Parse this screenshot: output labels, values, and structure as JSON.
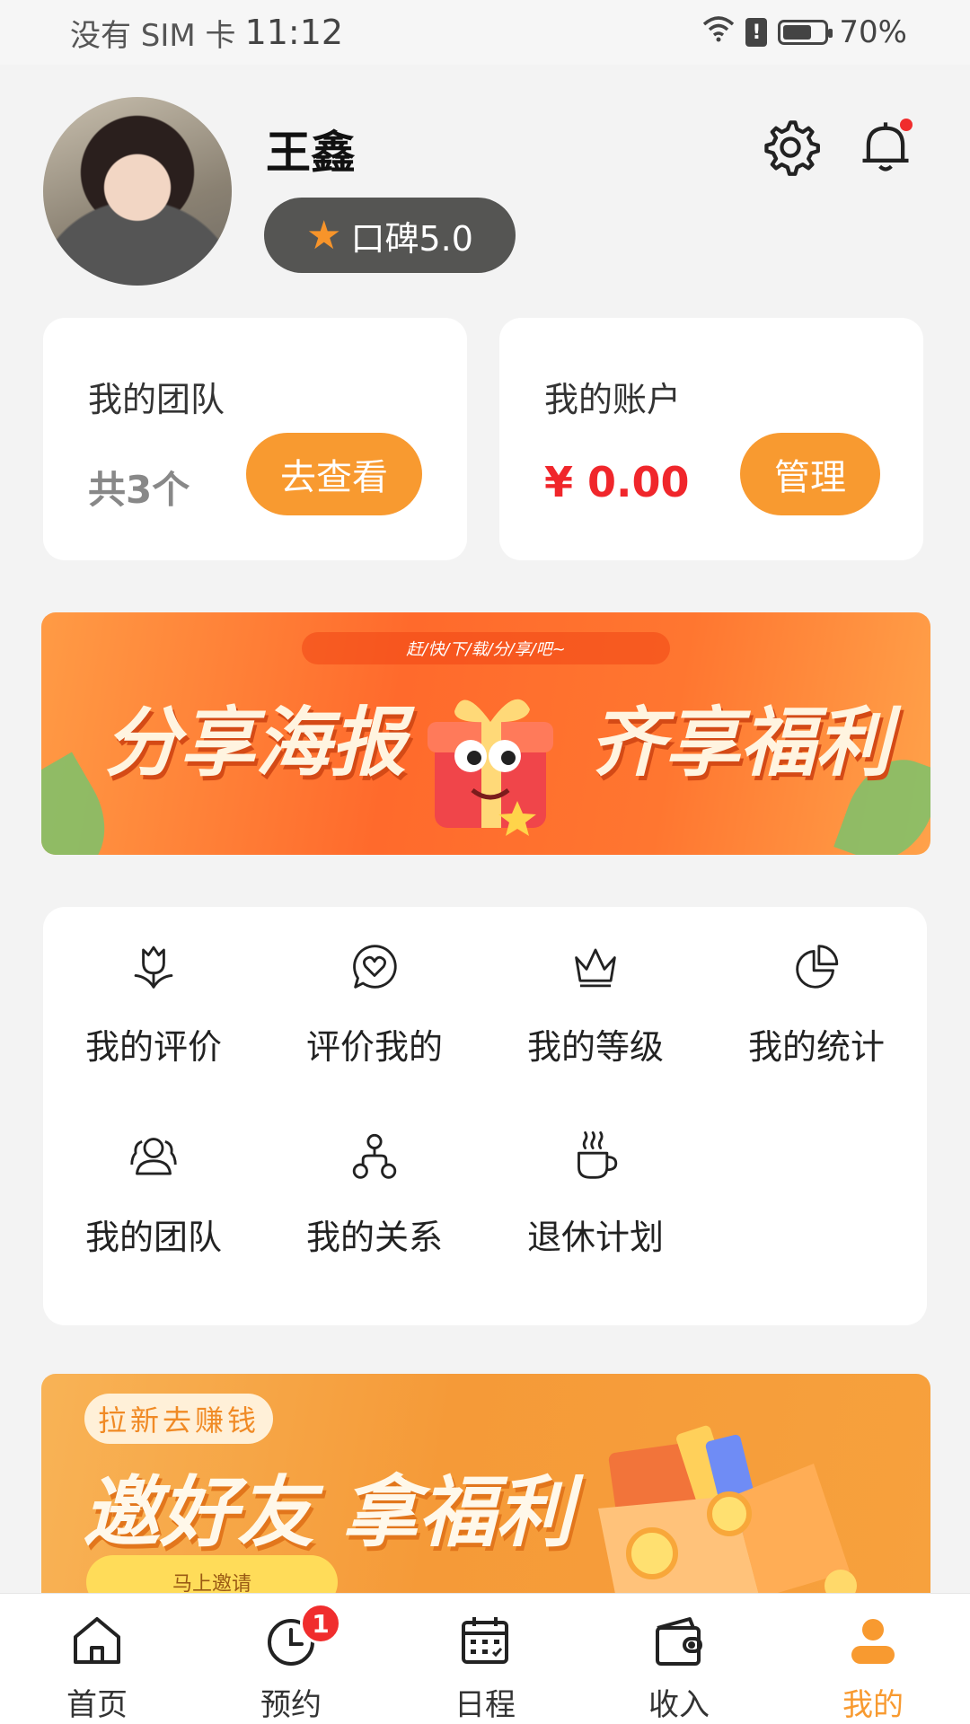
{
  "status_bar": {
    "carrier": "没有 SIM 卡",
    "time": "11:12",
    "battery": "70%",
    "battery_level": 0.7
  },
  "profile": {
    "name": "王鑫",
    "rating_label": "口碑5.0",
    "has_notification": true
  },
  "team_card": {
    "title": "我的团队",
    "count": "共3个",
    "button": "去查看"
  },
  "account_card": {
    "title": "我的账户",
    "balance": "¥ 0.00",
    "button": "管理"
  },
  "banner1": {
    "tag": "赶/快/下/载/分/享/吧~",
    "left_text": "分享海报",
    "right_text": "齐享福利"
  },
  "menu": {
    "items": [
      {
        "label": "我的评价",
        "icon": "tulip-icon"
      },
      {
        "label": "评价我的",
        "icon": "heart-chat-icon"
      },
      {
        "label": "我的等级",
        "icon": "crown-icon"
      },
      {
        "label": "我的统计",
        "icon": "pie-chart-icon"
      },
      {
        "label": "我的团队",
        "icon": "team-icon"
      },
      {
        "label": "我的关系",
        "icon": "relation-icon"
      },
      {
        "label": "退休计划",
        "icon": "coffee-cup-icon"
      }
    ]
  },
  "banner2": {
    "tag": "拉新去赚钱",
    "headline": "邀好友 拿福利",
    "button": "马上邀请"
  },
  "tabbar": {
    "tabs": [
      {
        "label": "首页",
        "icon": "home-icon"
      },
      {
        "label": "预约",
        "icon": "clock-icon",
        "badge": "1"
      },
      {
        "label": "日程",
        "icon": "calendar-icon"
      },
      {
        "label": "收入",
        "icon": "wallet-icon"
      },
      {
        "label": "我的",
        "icon": "user-icon",
        "active": true
      }
    ]
  },
  "colors": {
    "accent": "#f89a30",
    "money": "#f0262b",
    "badge": "#f02d2d",
    "background": "#f3f3f3"
  }
}
